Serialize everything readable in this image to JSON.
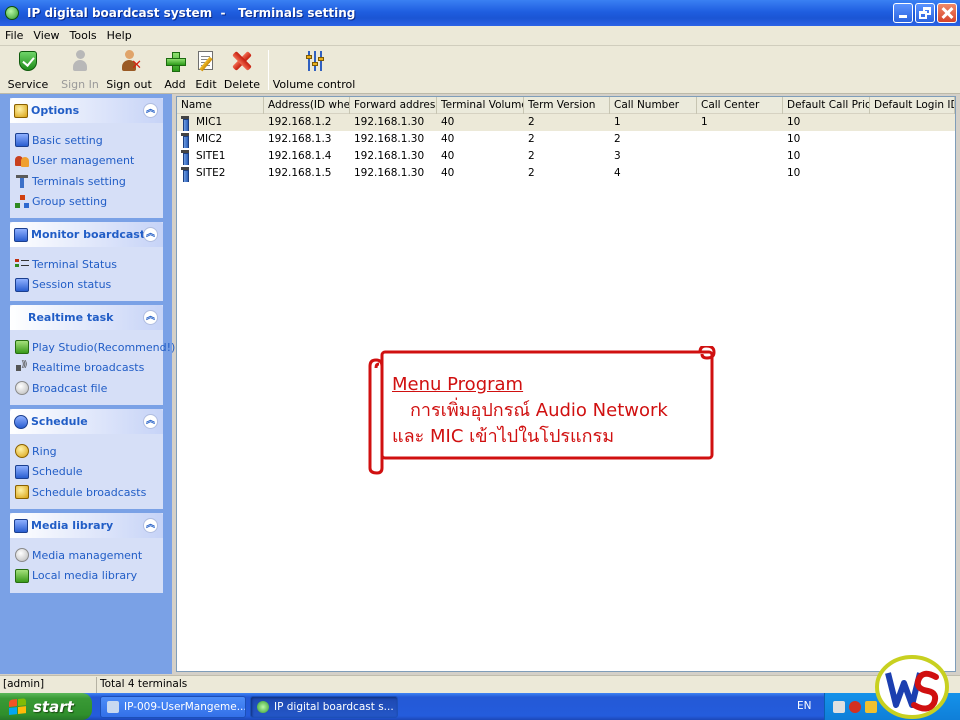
{
  "window": {
    "title": "IP digital boardcast system  -   Terminals setting"
  },
  "menu": [
    "File",
    "View",
    "Tools",
    "Help"
  ],
  "toolbar": [
    {
      "label": "Service",
      "icon": "service-shield-icon",
      "enabled": true
    },
    {
      "label": "Sign In",
      "icon": "sign-in-user-icon",
      "enabled": false
    },
    {
      "label": "Sign out",
      "icon": "sign-out-user-icon",
      "enabled": true
    },
    {
      "label": "Add",
      "icon": "add-plus-icon",
      "enabled": true
    },
    {
      "label": "Edit",
      "icon": "edit-pencil-icon",
      "enabled": true
    },
    {
      "label": "Delete",
      "icon": "delete-x-icon",
      "enabled": true
    },
    {
      "label": "Volume control",
      "icon": "volume-sliders-icon",
      "enabled": true
    }
  ],
  "sidebar": {
    "options": {
      "title": "Options",
      "items": [
        "Basic setting",
        "User management",
        "Terminals setting",
        "Group setting"
      ]
    },
    "monitor": {
      "title": "Monitor boardcast",
      "items": [
        "Terminal Status",
        "Session status"
      ]
    },
    "realtime": {
      "title": "Realtime task",
      "items": [
        "Play Studio(Recommend!)",
        "Realtime broadcasts",
        "Broadcast file"
      ]
    },
    "schedule": {
      "title": "Schedule",
      "items": [
        "Ring",
        "Schedule",
        "Schedule broadcasts"
      ]
    },
    "media": {
      "title": "Media library",
      "items": [
        "Media management",
        "Local media library"
      ]
    }
  },
  "table": {
    "columns": [
      "Name",
      "Address(ID whe...",
      "Forward address",
      "Terminal Volume",
      "Term Version",
      "Call Number",
      "Call Center",
      "Default Call Prior...",
      "Default Login ID"
    ],
    "rows": [
      [
        "MIC1",
        "192.168.1.2",
        "192.168.1.30",
        "40",
        "2",
        "1",
        "1",
        "10",
        ""
      ],
      [
        "MIC2",
        "192.168.1.3",
        "192.168.1.30",
        "40",
        "2",
        "2",
        "",
        "10",
        ""
      ],
      [
        "SITE1",
        "192.168.1.4",
        "192.168.1.30",
        "40",
        "2",
        "3",
        "",
        "10",
        ""
      ],
      [
        "SITE2",
        "192.168.1.5",
        "192.168.1.30",
        "40",
        "2",
        "4",
        "",
        "10",
        ""
      ]
    ],
    "selected_row": 0
  },
  "callout": {
    "title": "Menu Program",
    "line1": "การเพิ่มอุปกรณ์ Audio Network",
    "line2": "และ MIC เข้าไปในโปรแกรม",
    "color": "#d01010"
  },
  "status": {
    "user": "[admin]",
    "total": "Total 4 terminals"
  },
  "taskbar": {
    "start_label": "start",
    "tasks": [
      "IP-009-UserMangeme...",
      "IP digital boardcast s..."
    ],
    "active_task": 1,
    "language": "EN"
  },
  "colors": {
    "titlebar": "#1f5ee0",
    "sidebar_bg": "#7aa1e6",
    "sidebar_link": "#215dc6",
    "taskbar": "#245cdc",
    "start_button": "#3a9a36"
  }
}
